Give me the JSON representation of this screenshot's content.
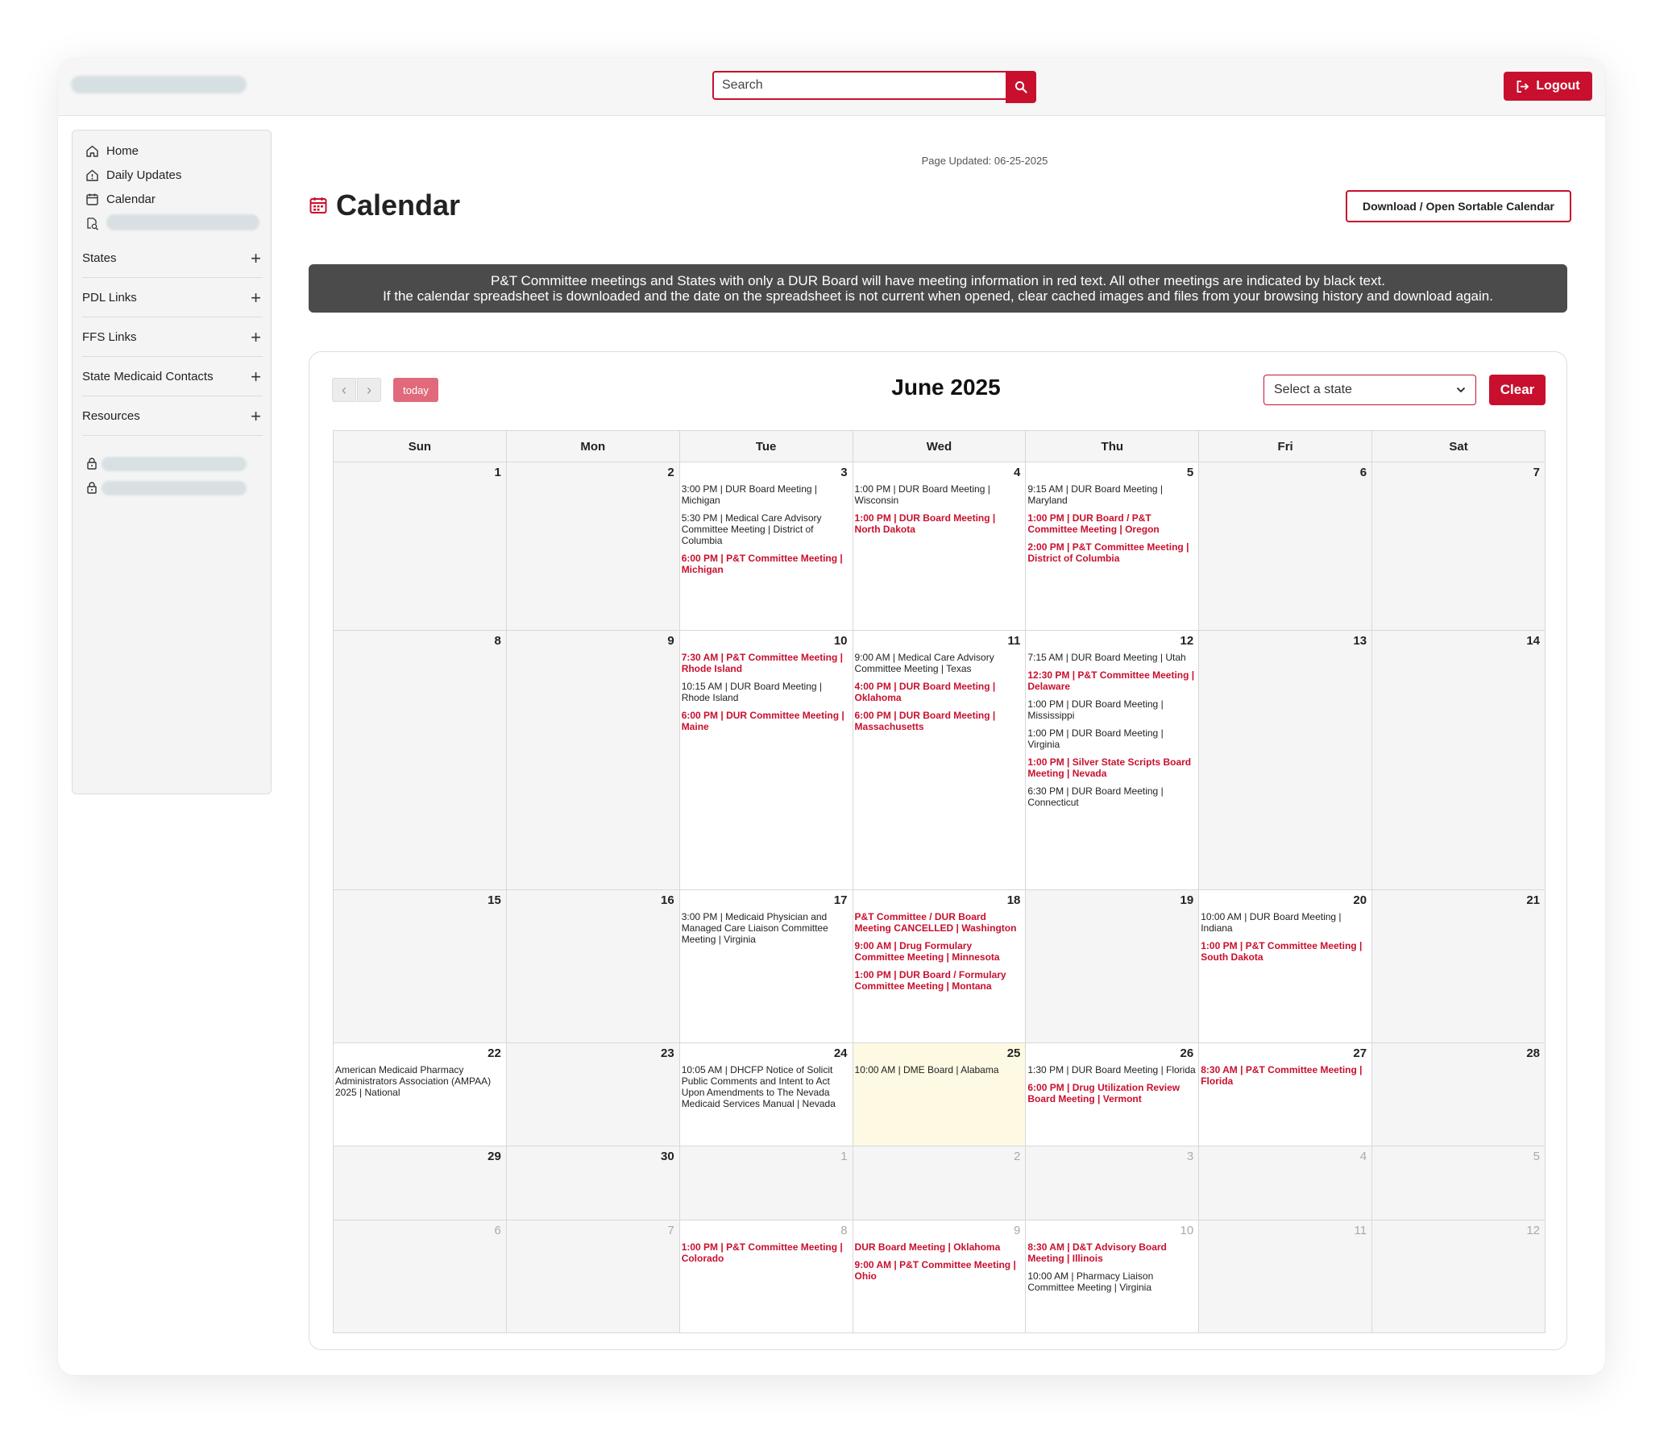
{
  "header": {
    "search_placeholder": "Search",
    "logout_label": "Logout"
  },
  "sidebar": {
    "links": [
      {
        "label": "Home",
        "icon": "home-icon"
      },
      {
        "label": "Daily Updates",
        "icon": "house-alert-icon"
      },
      {
        "label": "Calendar",
        "icon": "calendar-icon"
      }
    ],
    "sections": [
      {
        "label": "States"
      },
      {
        "label": "PDL Links"
      },
      {
        "label": "FFS Links"
      },
      {
        "label": "State Medicaid Contacts"
      },
      {
        "label": "Resources"
      }
    ]
  },
  "main": {
    "page_updated": "Page Updated: 06-25-2025",
    "title": "Calendar",
    "download_label": "Download / Open Sortable Calendar",
    "banner_line1": "P&T Committee meetings and States with only a DUR Board will have meeting information in red text. All other meetings are indicated by black text.",
    "banner_line2": "If the calendar spreadsheet is downloaded and the date on the spreadsheet is not current when opened, clear cached images and files from your browsing history and download again."
  },
  "calendar": {
    "prev_glyph": "‹",
    "next_glyph": "›",
    "today_label": "today",
    "month_title": "June 2025",
    "state_select_value": "Select a state",
    "clear_label": "Clear",
    "weekdays": [
      "Sun",
      "Mon",
      "Tue",
      "Wed",
      "Thu",
      "Fri",
      "Sat"
    ],
    "colors": {
      "red": "#c8102e",
      "today_bg": "#fdf9e3"
    },
    "weeks": [
      {
        "days": [
          {
            "n": "1",
            "events": []
          },
          {
            "n": "2",
            "events": []
          },
          {
            "n": "3",
            "events": [
              {
                "text": "3:00 PM | DUR Board Meeting | Michigan",
                "red": false
              },
              {
                "text": "5:30 PM | Medical Care Advisory Committee Meeting | District of Columbia",
                "red": false
              },
              {
                "text": "6:00 PM | P&T Committee Meeting | Michigan",
                "red": true
              }
            ]
          },
          {
            "n": "4",
            "events": [
              {
                "text": "1:00 PM | DUR Board Meeting | Wisconsin",
                "red": false
              },
              {
                "text": "1:00 PM | DUR Board Meeting | North Dakota",
                "red": true
              }
            ]
          },
          {
            "n": "5",
            "events": [
              {
                "text": "9:15 AM | DUR Board Meeting | Maryland",
                "red": false
              },
              {
                "text": "1:00 PM | DUR Board / P&T Committee Meeting | Oregon",
                "red": true
              },
              {
                "text": "2:00 PM | P&T Committee Meeting | District of Columbia",
                "red": true
              }
            ]
          },
          {
            "n": "6",
            "events": []
          },
          {
            "n": "7",
            "events": []
          }
        ]
      },
      {
        "days": [
          {
            "n": "8",
            "events": []
          },
          {
            "n": "9",
            "events": []
          },
          {
            "n": "10",
            "events": [
              {
                "text": "7:30 AM | P&T Committee Meeting | Rhode Island",
                "red": true
              },
              {
                "text": "10:15 AM | DUR Board Meeting | Rhode Island",
                "red": false
              },
              {
                "text": "6:00 PM | DUR Committee Meeting | Maine",
                "red": true
              }
            ]
          },
          {
            "n": "11",
            "events": [
              {
                "text": "9:00 AM | Medical Care Advisory Committee Meeting | Texas",
                "red": false
              },
              {
                "text": "4:00 PM | DUR Board Meeting | Oklahoma",
                "red": true
              },
              {
                "text": "6:00 PM | DUR Board Meeting | Massachusetts",
                "red": true
              }
            ]
          },
          {
            "n": "12",
            "events": [
              {
                "text": "7:15 AM | DUR Board Meeting | Utah",
                "red": false
              },
              {
                "text": "12:30 PM | P&T Committee Meeting | Delaware",
                "red": true
              },
              {
                "text": "1:00 PM | DUR Board Meeting | Mississippi",
                "red": false
              },
              {
                "text": "1:00 PM | DUR Board Meeting | Virginia",
                "red": false
              },
              {
                "text": "1:00 PM | Silver State Scripts Board Meeting | Nevada",
                "red": true
              },
              {
                "text": "6:30 PM | DUR Board Meeting | Connecticut",
                "red": false
              }
            ]
          },
          {
            "n": "13",
            "events": []
          },
          {
            "n": "14",
            "events": []
          }
        ]
      },
      {
        "days": [
          {
            "n": "15",
            "events": []
          },
          {
            "n": "16",
            "events": []
          },
          {
            "n": "17",
            "events": [
              {
                "text": "3:00 PM | Medicaid Physician and Managed Care Liaison Committee Meeting | Virginia",
                "red": false
              }
            ]
          },
          {
            "n": "18",
            "events": [
              {
                "text": "P&T Committee / DUR Board Meeting CANCELLED | Washington",
                "red": true
              },
              {
                "text": "9:00 AM | Drug Formulary Committee Meeting | Minnesota",
                "red": true
              },
              {
                "text": "1:00 PM | DUR Board / Formulary Committee Meeting | Montana",
                "red": true
              }
            ]
          },
          {
            "n": "19",
            "events": []
          },
          {
            "n": "20",
            "events": [
              {
                "text": "10:00 AM | DUR Board Meeting | Indiana",
                "red": false
              },
              {
                "text": "1:00 PM | P&T Committee Meeting | South Dakota",
                "red": true
              }
            ]
          },
          {
            "n": "21",
            "events": []
          }
        ]
      },
      {
        "days": [
          {
            "n": "22",
            "events": [
              {
                "text": "American Medicaid Pharmacy Administrators Association (AMPAA) 2025 | National",
                "red": false
              }
            ]
          },
          {
            "n": "23",
            "events": []
          },
          {
            "n": "24",
            "events": [
              {
                "text": "10:05 AM | DHCFP Notice of Solicit Public Comments and Intent to Act Upon Amendments to The Nevada Medicaid Services Manual | Nevada",
                "red": false
              }
            ]
          },
          {
            "n": "25",
            "events": [
              {
                "text": "10:00 AM | DME Board | Alabama",
                "red": false
              }
            ]
          },
          {
            "n": "26",
            "events": [
              {
                "text": "1:30 PM | DUR Board Meeting | Florida",
                "red": false
              },
              {
                "text": "6:00 PM | Drug Utilization Review Board Meeting | Vermont",
                "red": true
              }
            ]
          },
          {
            "n": "27",
            "events": [
              {
                "text": "8:30 AM | P&T Committee Meeting | Florida",
                "red": true
              }
            ]
          },
          {
            "n": "28",
            "events": []
          }
        ]
      },
      {
        "days": [
          {
            "n": "29",
            "events": []
          },
          {
            "n": "30",
            "events": []
          },
          {
            "n": "1",
            "events": []
          },
          {
            "n": "2",
            "events": []
          },
          {
            "n": "3",
            "events": []
          },
          {
            "n": "4",
            "events": []
          },
          {
            "n": "5",
            "events": []
          }
        ]
      },
      {
        "days": [
          {
            "n": "6",
            "events": []
          },
          {
            "n": "7",
            "events": []
          },
          {
            "n": "8",
            "events": [
              {
                "text": "1:00 PM | P&T Committee Meeting | Colorado",
                "red": true
              }
            ]
          },
          {
            "n": "9",
            "events": [
              {
                "text": "DUR Board Meeting | Oklahoma",
                "red": true
              },
              {
                "text": "9:00 AM | P&T Committee Meeting | Ohio",
                "red": true
              }
            ]
          },
          {
            "n": "10",
            "events": [
              {
                "text": "8:30 AM | D&T Advisory Board Meeting | Illinois",
                "red": true
              },
              {
                "text": "10:00 AM | Pharmacy Liaison Committee Meeting | Virginia",
                "red": false
              }
            ]
          },
          {
            "n": "11",
            "events": []
          },
          {
            "n": "12",
            "events": []
          }
        ]
      }
    ]
  }
}
